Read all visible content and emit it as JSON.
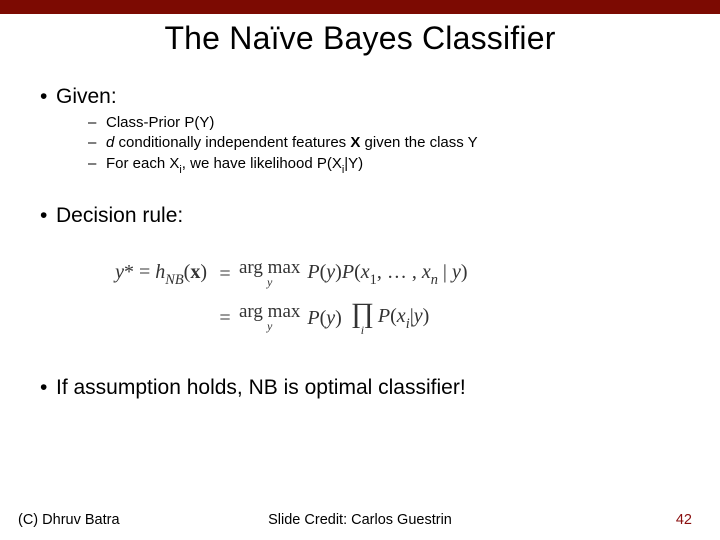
{
  "title": "The Naïve Bayes Classifier",
  "bullets": {
    "given": {
      "label": "Given:",
      "sub": [
        "Class-Prior P(Y)",
        "d conditionally independent features X given the class Y",
        "For each X_i, we have likelihood P(X_i|Y)"
      ]
    },
    "decision": {
      "label": "Decision rule:"
    },
    "optimal": {
      "label": "If assumption holds, NB is optimal classifier!"
    }
  },
  "equation": {
    "lhs": "y* = h_NB(x)",
    "line1_rhs": "arg max_y P(y) P(x_1, …, x_n | y)",
    "line2_rhs": "arg max_y P(y) ∏_i P(x_i | y)"
  },
  "footer": {
    "copyright": "(C) Dhruv Batra",
    "credit": "Slide Credit: Carlos Guestrin",
    "page": "42"
  }
}
